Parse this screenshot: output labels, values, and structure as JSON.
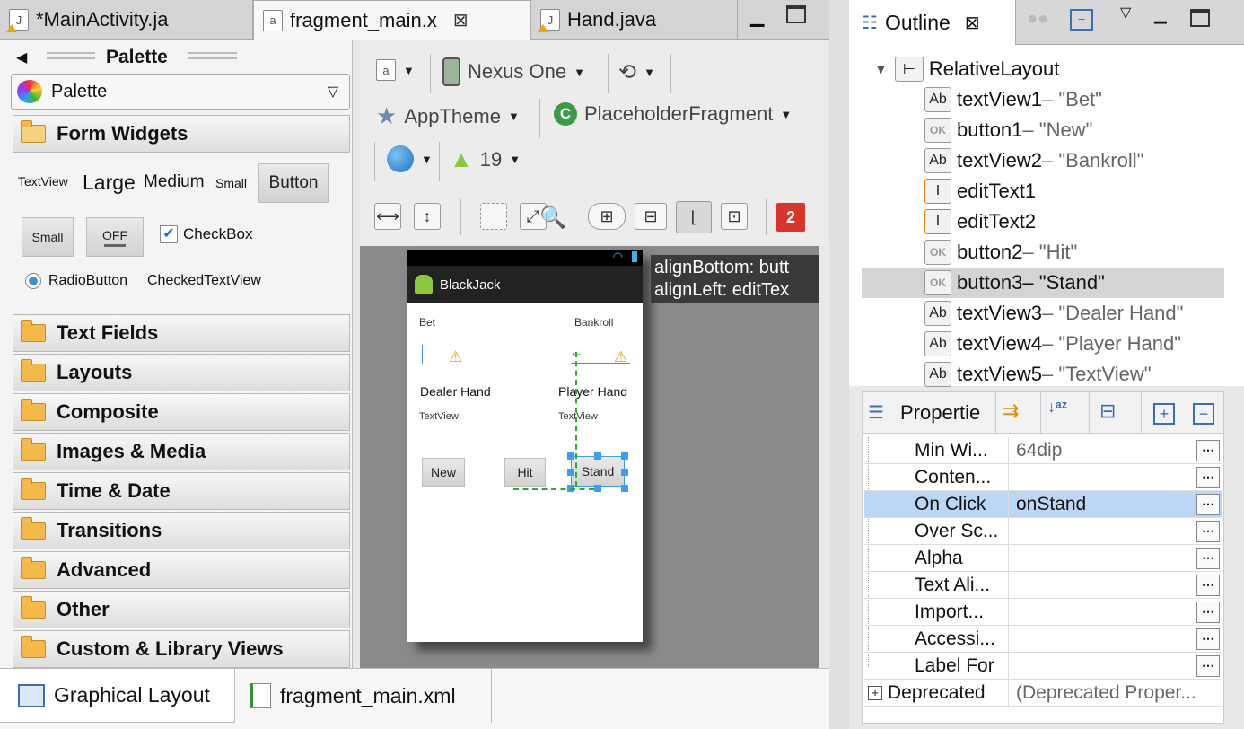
{
  "editor_tabs": [
    {
      "label": "*MainActivity.ja",
      "icon": "java-file-icon"
    },
    {
      "label": "fragment_main.x",
      "icon": "xml-layout-file-icon"
    },
    {
      "label": "Hand.java",
      "icon": "java-file-icon"
    }
  ],
  "palette": {
    "header": "Palette",
    "dropdown": "Palette",
    "form_widgets": {
      "title": "Form Widgets",
      "textview": "TextView",
      "large": "Large",
      "medium": "Medium",
      "small": "Small",
      "button": "Button",
      "small_button": "Small",
      "toggle": "OFF",
      "checkbox": "CheckBox",
      "radio": "RadioButton",
      "checked_textview": "CheckedTextView"
    },
    "categories": [
      "Text Fields",
      "Layouts",
      "Composite",
      "Images & Media",
      "Time & Date",
      "Transitions",
      "Advanced",
      "Other",
      "Custom & Library Views"
    ]
  },
  "toolbar": {
    "device": "Nexus One",
    "theme": "AppTheme",
    "activity": "PlaceholderFragment",
    "api": "19",
    "error_count": "2"
  },
  "device_preview": {
    "app_title": "BlackJack",
    "bet": "Bet",
    "bankroll": "Bankroll",
    "dealer_hand": "Dealer Hand",
    "player_hand": "Player Hand",
    "textview_left": "TextView",
    "textview_right": "TextView",
    "btn_new": "New",
    "btn_hit": "Hit",
    "btn_stand": "Stand",
    "tooltip_line1": "alignBottom: butt",
    "tooltip_line2": "alignLeft: editTex"
  },
  "bottom_tabs": [
    "Graphical Layout",
    "fragment_main.xml"
  ],
  "outline": {
    "tab": "Outline",
    "root": "RelativeLayout",
    "items": [
      {
        "name": "textView1",
        "value": " – \"Bet\"",
        "icon": "Ab"
      },
      {
        "name": "button1",
        "value": " – \"New\"",
        "icon": "OK"
      },
      {
        "name": "textView2",
        "value": " – \"Bankroll\"",
        "icon": "Ab"
      },
      {
        "name": "editText1",
        "value": "",
        "icon": "I"
      },
      {
        "name": "editText2",
        "value": "",
        "icon": "I"
      },
      {
        "name": "button2",
        "value": " – \"Hit\"",
        "icon": "OK"
      },
      {
        "name": "button3",
        "value": " – \"Stand\"",
        "icon": "OK"
      },
      {
        "name": "textView3",
        "value": " – \"Dealer Hand\"",
        "icon": "Ab"
      },
      {
        "name": "textView4",
        "value": " – \"Player Hand\"",
        "icon": "Ab"
      },
      {
        "name": "textView5",
        "value": " – \"TextView\"",
        "icon": "Ab"
      }
    ]
  },
  "properties": {
    "tab": "Propertie",
    "rows": [
      {
        "name": "Min Wi...",
        "value": "64dip"
      },
      {
        "name": "Conten...",
        "value": ""
      },
      {
        "name": "On Click",
        "value": "onStand"
      },
      {
        "name": "Over Sc...",
        "value": ""
      },
      {
        "name": "Alpha",
        "value": ""
      },
      {
        "name": "Text Ali...",
        "value": ""
      },
      {
        "name": "Import...",
        "value": ""
      },
      {
        "name": "Accessi...",
        "value": ""
      },
      {
        "name": "Label For",
        "value": ""
      }
    ],
    "deprecated_name": "Deprecated",
    "deprecated_value": "(Deprecated Proper..."
  },
  "colors": {
    "selection": "#bcd7f5",
    "outline_selected": "#d4d4d4",
    "error_badge": "#d9352a",
    "handle": "#3a9ff2",
    "guide": "#2fa82f"
  }
}
